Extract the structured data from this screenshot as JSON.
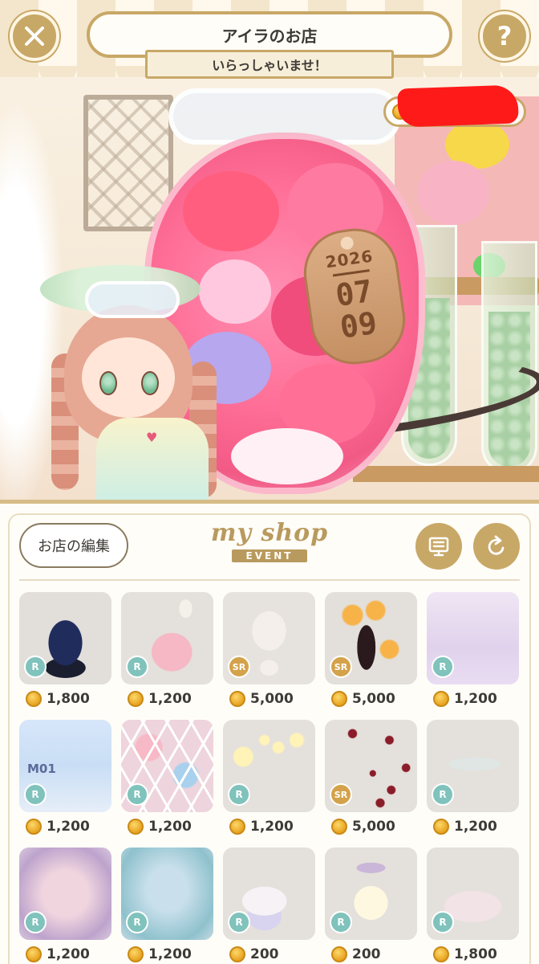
{
  "header": {
    "shop_title": "アイラのお店",
    "welcome": "いらっしゃいませ！",
    "close_icon": "close-icon",
    "help_label": "?"
  },
  "scene": {
    "tag_year": "2026",
    "tag_month": "07",
    "tag_day": "09"
  },
  "panel": {
    "edit_label": "お店の編集",
    "logo_main": "my shop",
    "logo_sub": "EVENT",
    "board_icon": "board-icon",
    "refresh_icon": "refresh-icon"
  },
  "items": [
    {
      "name": "navy-coat-dress",
      "rarity": "R",
      "price": "1,800",
      "bg": "#e2deda"
    },
    {
      "name": "pink-ruffle-dress",
      "rarity": "R",
      "price": "1,200",
      "bg": "#e4e0dc"
    },
    {
      "name": "face-head",
      "rarity": "SR",
      "price": "5,000",
      "bg": "#e6e2de"
    },
    {
      "name": "dark-tree-lanterns",
      "rarity": "SR",
      "price": "5,000",
      "bg": "#e3dfdb"
    },
    {
      "name": "lilac-jellyfish-bg",
      "rarity": "R",
      "price": "1,200",
      "bg": "#e8dcf0"
    },
    {
      "name": "harp-room-m01",
      "rarity": "R",
      "price": "1,200",
      "bg": "#cfe0f6",
      "label": "M01"
    },
    {
      "name": "floral-lattice",
      "rarity": "R",
      "price": "1,200",
      "bg": "#f0d6df"
    },
    {
      "name": "moon-stars-garland",
      "rarity": "R",
      "price": "1,200",
      "bg": "#e4e0db"
    },
    {
      "name": "red-petals",
      "rarity": "SR",
      "price": "5,000",
      "bg": "#e4e0db"
    },
    {
      "name": "lily-pond-flowers",
      "rarity": "R",
      "price": "1,200",
      "bg": "#e4e0db"
    },
    {
      "name": "purple-frame-bg",
      "rarity": "R",
      "price": "1,200",
      "bg": "#d9c8df"
    },
    {
      "name": "teal-frame-feather",
      "rarity": "R",
      "price": "1,200",
      "bg": "#c6dbe4"
    },
    {
      "name": "milk-teacup",
      "rarity": "R",
      "price": "200",
      "bg": "#e4e0db"
    },
    {
      "name": "light-jar",
      "rarity": "R",
      "price": "200",
      "bg": "#e4e0db"
    },
    {
      "name": "cookie-plate",
      "rarity": "R",
      "price": "1,800",
      "bg": "#e4e0db"
    }
  ],
  "colors": {
    "gold": "#c8a867",
    "rarity_r": "#80c2bc",
    "rarity_sr": "#d4a24a",
    "redaction": "#ff1a1a"
  }
}
